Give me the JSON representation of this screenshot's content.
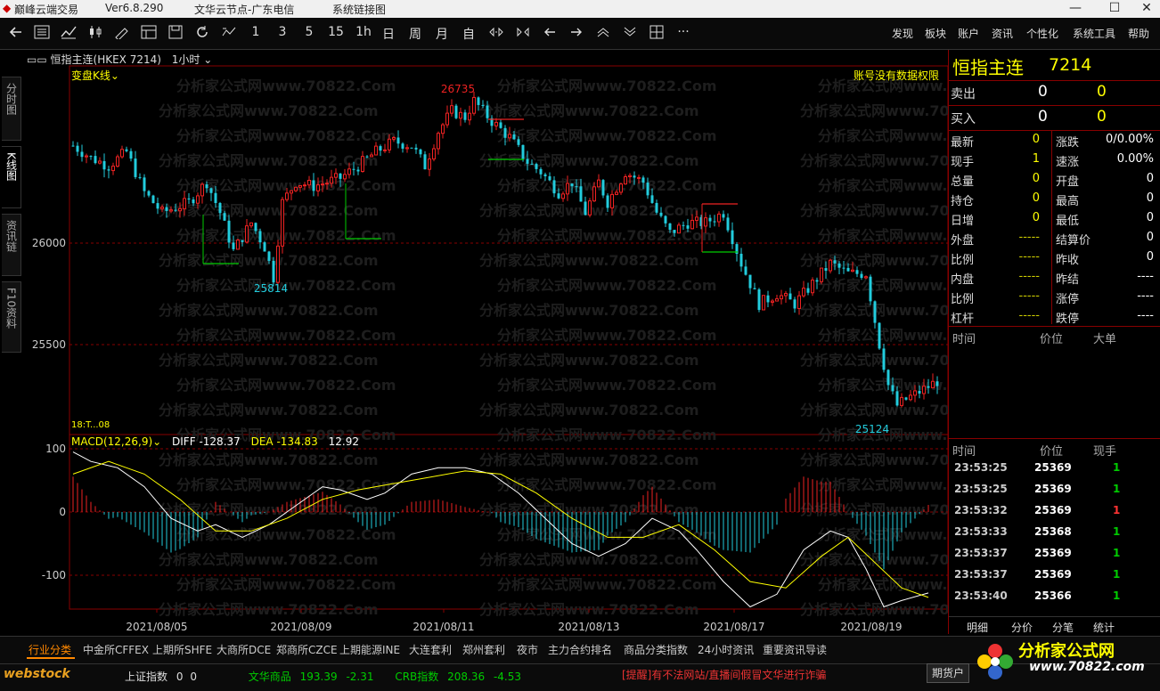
{
  "window": {
    "app_title": "巅峰云端交易",
    "version": "Ver6.8.290",
    "server": "文华云节点-广东电信",
    "sys_link": "系统链接图"
  },
  "toolbar": {
    "periods": [
      "1",
      "3",
      "5",
      "15",
      "1h",
      "日",
      "周",
      "月",
      "自"
    ],
    "menus": [
      "发现",
      "板块",
      "账户",
      "资讯",
      "个性化",
      "系统工具",
      "帮助"
    ]
  },
  "left_tabs": [
    "分时图",
    "K线图",
    "资讯链",
    "F10资料"
  ],
  "instrument": {
    "header": "恒指主连(HKEX 7214)",
    "period": "1小时",
    "kline_mode": "变盘K线",
    "no_permission": "账号没有数据权限",
    "name_big": "恒指主连",
    "code_big": "7214"
  },
  "main_chart": {
    "y_ticks": [
      "26000",
      "25500"
    ],
    "high_label": "26735",
    "low_label1": "25814",
    "low_label2": "25124",
    "corner_label": "18:T...08",
    "x_dates": [
      "2021/08/05",
      "2021/08/09",
      "2021/08/11",
      "2021/08/13",
      "2021/08/17",
      "2021/08/19"
    ]
  },
  "macd": {
    "label": "MACD(12,26,9)",
    "diff_label": "DIFF",
    "diff": "-128.37",
    "dea_label": "DEA",
    "dea": "-134.83",
    "macd": "12.92",
    "y_ticks": [
      "100",
      "0",
      "-100"
    ]
  },
  "quote": {
    "sell_label": "卖出",
    "sell_price": "0",
    "sell_vol": "0",
    "buy_label": "买入",
    "buy_price": "0",
    "buy_vol": "0",
    "rows_left": [
      {
        "k": "最新",
        "v": "0"
      },
      {
        "k": "现手",
        "v": "1"
      },
      {
        "k": "总量",
        "v": "0"
      },
      {
        "k": "持仓",
        "v": "0"
      },
      {
        "k": "日增",
        "v": "0"
      },
      {
        "k": "外盘",
        "v": "-----"
      },
      {
        "k": "比例",
        "v": "-----"
      },
      {
        "k": "内盘",
        "v": "-----"
      },
      {
        "k": "比例",
        "v": "-----"
      },
      {
        "k": "杠杆",
        "v": "-----"
      }
    ],
    "rows_right": [
      {
        "k": "涨跌",
        "v": "0/0.00%"
      },
      {
        "k": "速涨",
        "v": "0.00%"
      },
      {
        "k": "开盘",
        "v": "0"
      },
      {
        "k": "最高",
        "v": "0"
      },
      {
        "k": "最低",
        "v": "0"
      },
      {
        "k": "结算价",
        "v": "0"
      },
      {
        "k": "昨收",
        "v": "0"
      },
      {
        "k": "昨结",
        "v": "----"
      },
      {
        "k": "涨停",
        "v": "----"
      },
      {
        "k": "跌停",
        "v": "----"
      }
    ],
    "bigorder_headers": [
      "时间",
      "价位",
      "大单"
    ],
    "tick_headers": [
      "时间",
      "价位",
      "现手"
    ],
    "ticks": [
      {
        "t": "23:53:25",
        "p": "25369",
        "v": "1",
        "c": "green"
      },
      {
        "t": "23:53:25",
        "p": "25369",
        "v": "1",
        "c": "green"
      },
      {
        "t": "23:53:32",
        "p": "25369",
        "v": "1",
        "c": "red"
      },
      {
        "t": "23:53:33",
        "p": "25368",
        "v": "1",
        "c": "green"
      },
      {
        "t": "23:53:37",
        "p": "25369",
        "v": "1",
        "c": "green"
      },
      {
        "t": "23:53:37",
        "p": "25369",
        "v": "1",
        "c": "green"
      },
      {
        "t": "23:53:40",
        "p": "25366",
        "v": "1",
        "c": "green"
      }
    ],
    "right_tabs": [
      "明细",
      "分价",
      "分笔",
      "统计"
    ]
  },
  "bottom": {
    "tabs": [
      "行业分类",
      "中金所CFFEX",
      "上期所SHFE",
      "大商所DCE",
      "郑商所CZCE",
      "上期能源INE",
      "大连套利",
      "郑州套利",
      "夜市",
      "主力合约排名",
      "商品分类指数",
      "24小时资讯",
      "重要资讯导读"
    ],
    "brand": "webstock",
    "sh_label": "上证指数",
    "sh_v1": "0",
    "sh_v2": "0",
    "wh_label": "文华商品",
    "wh_v1": "193.39",
    "wh_v2": "-2.31",
    "crb_label": "CRB指数",
    "crb_v1": "208.36",
    "crb_v2": "-4.53",
    "warning": "[提醒]有不法网站/直播间假冒文华进行诈骗",
    "futures_btn": "期货户",
    "logo_text": "分析家公式网",
    "logo_url": "www.70822.com"
  },
  "watermark": "分析家公式网www.70822.Com"
}
